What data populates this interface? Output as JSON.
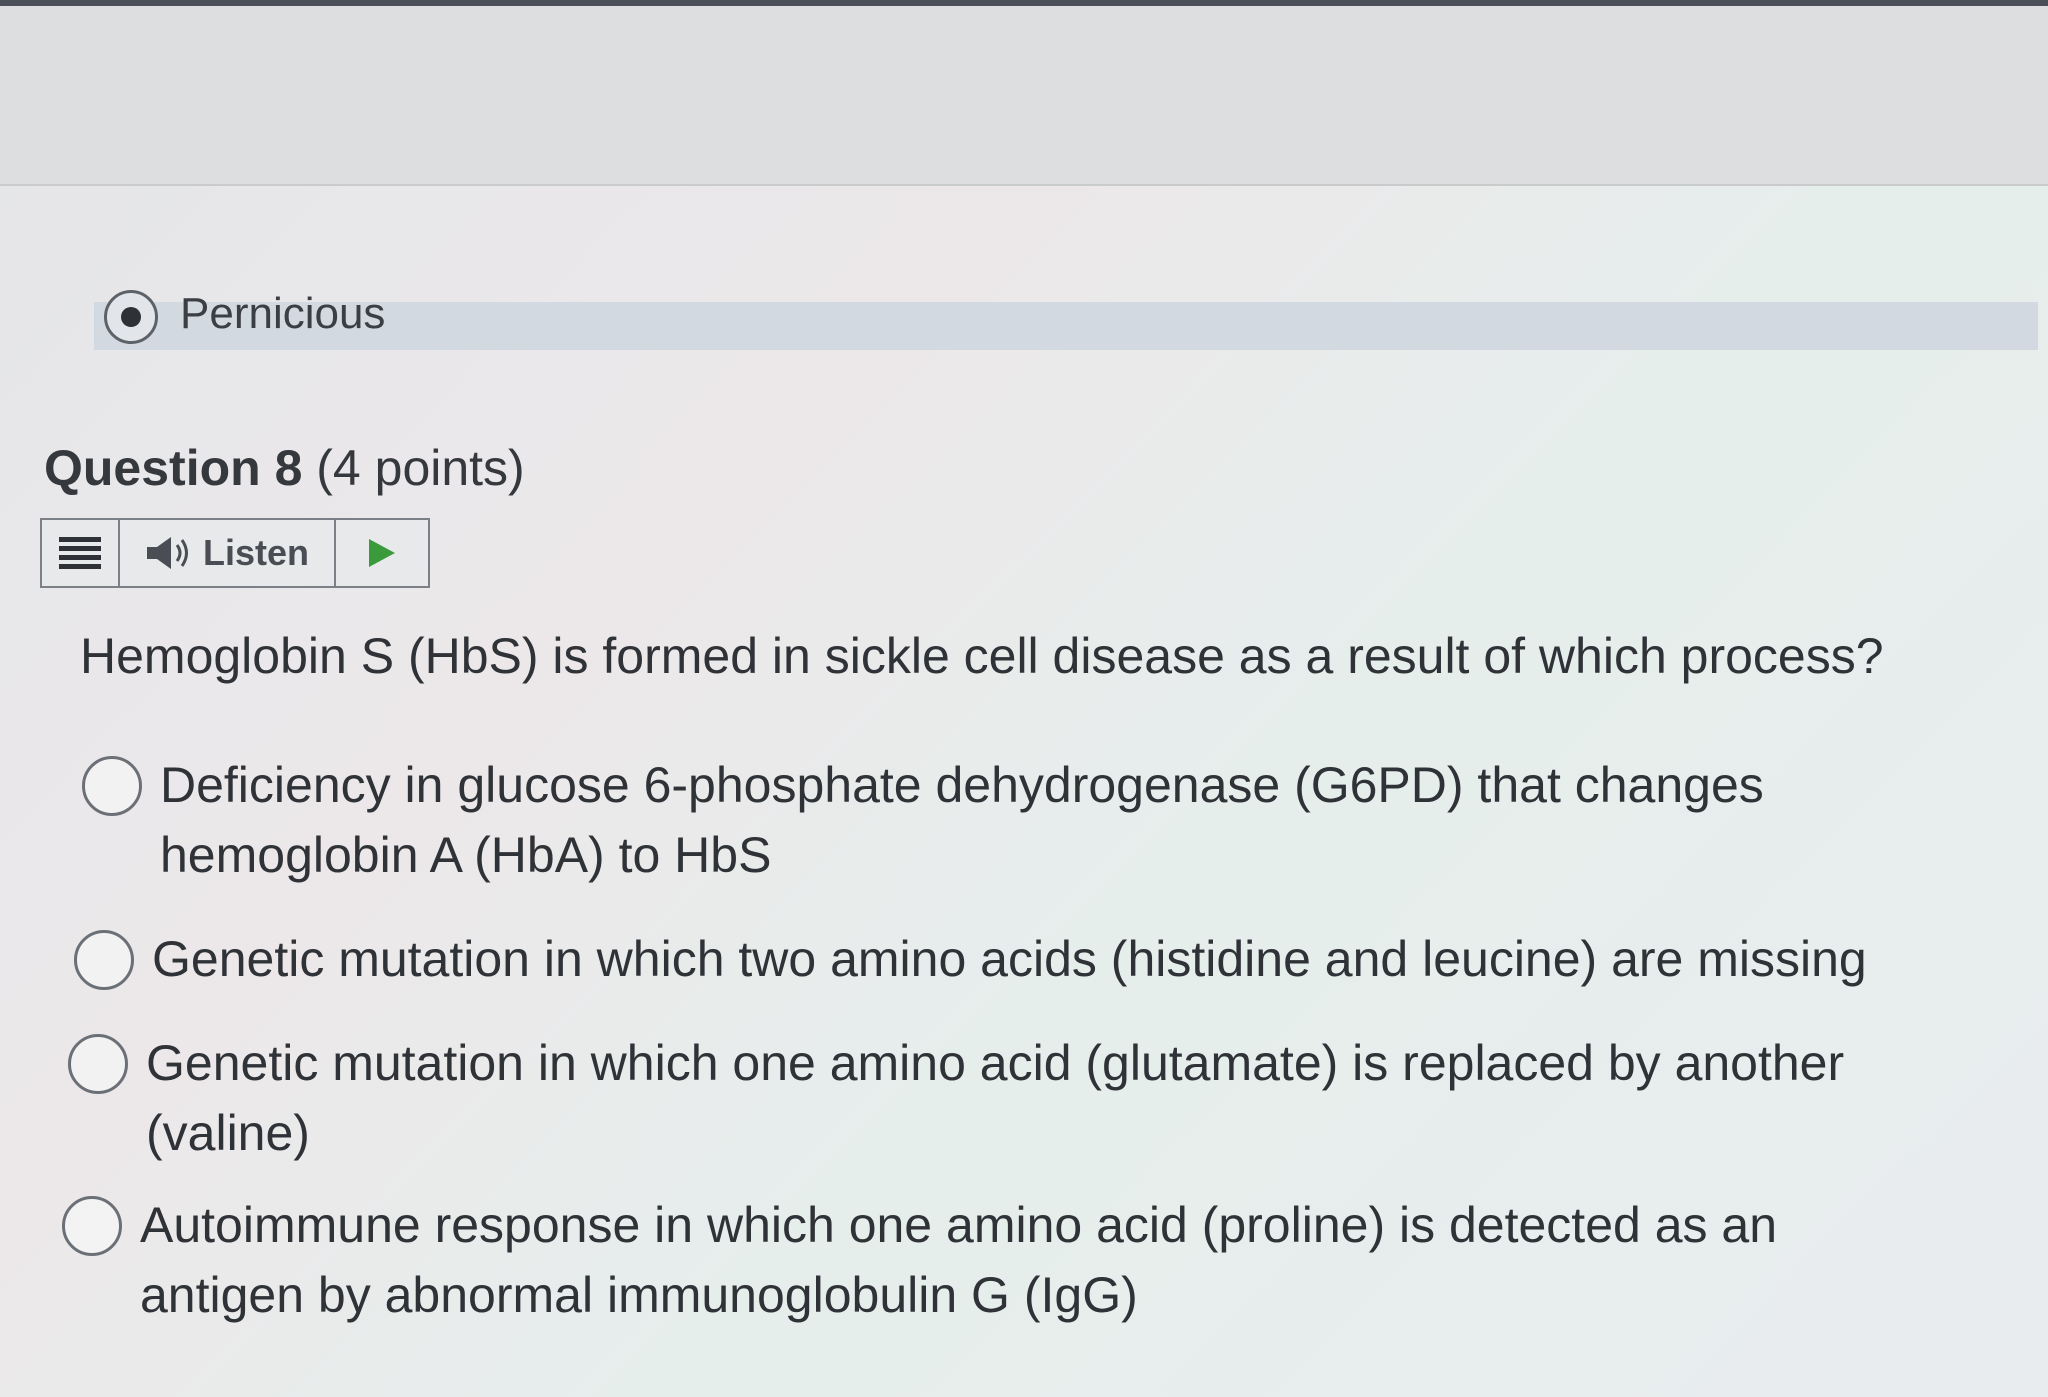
{
  "previous_question": {
    "selected_answer": "Pernicious"
  },
  "question": {
    "number_label": "Question 8",
    "points_label": "(4 points)",
    "prompt": "Hemoglobin S (HbS) is formed in sickle cell disease as a result of which process?"
  },
  "listen_bar": {
    "menu_icon": "hamburger-icon",
    "speaker_icon": "speaker-icon",
    "listen_label": "Listen",
    "play_icon": "play-icon",
    "play_color": "#3b9a3b"
  },
  "options": [
    {
      "line1": "Deficiency in glucose 6-phosphate dehydrogenase (G6PD) that changes",
      "line2": "hemoglobin A (HbA) to HbS"
    },
    {
      "line1": "Genetic mutation in which two amino acids (histidine and leucine) are missing",
      "line2": ""
    },
    {
      "line1": "Genetic mutation in which one amino acid (glutamate) is replaced by another",
      "line2": "(valine)"
    },
    {
      "line1": "Autoimmune response in which one amino acid (proline) is detected as an",
      "line2": "antigen by abnormal immunoglobulin G (IgG)"
    }
  ]
}
